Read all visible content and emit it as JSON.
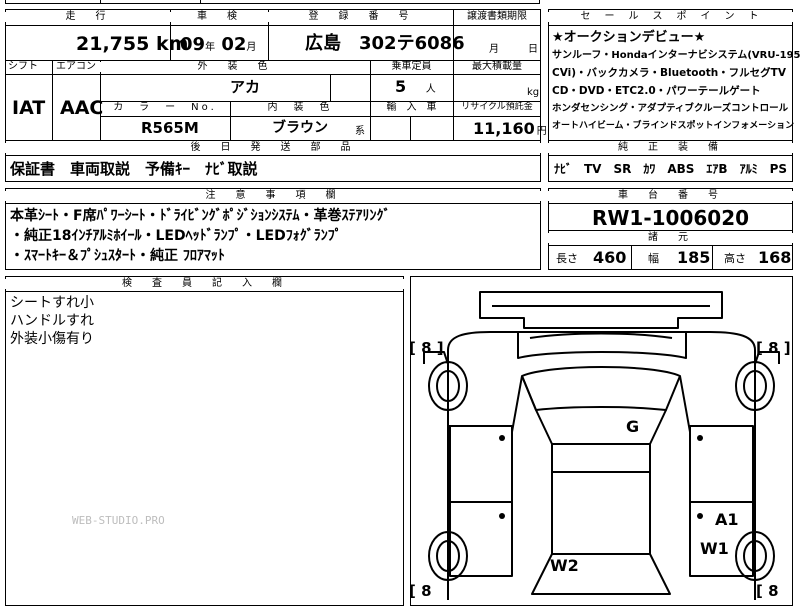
{
  "header": {
    "mileage_label": "走　行",
    "inspection_label": "車　検",
    "registration_label": "登　録　番　号",
    "transfer_label": "譲渡書類期限",
    "selling_label": "セ　ー　ル　ス　ポ　イ　ン　ト"
  },
  "mileage": {
    "value": "21,755",
    "unit": "km"
  },
  "inspection": {
    "year": "09",
    "year_unit": "年",
    "month": "02",
    "month_unit": "月"
  },
  "registration": {
    "value": "広島　302テ6086"
  },
  "transfer": {
    "month_unit": "月",
    "day_unit": "日"
  },
  "row2": {
    "shift_label": "シフト",
    "aircon_label": "エアコン",
    "exterior_label": "外　装　色",
    "capacity_label": "乗車定員",
    "load_label": "最大積載量",
    "shift": "IAT",
    "aircon": "AAC",
    "exterior": "アカ",
    "capacity": "5",
    "capacity_unit": "人",
    "load_unit": "kg",
    "colorno_label": "カ　ラ　ー　No.",
    "interior_label": "内　装　色",
    "import_label": "輸　入　車",
    "recycle_label": "リサイクル預託金",
    "colorno": "R565M",
    "interior": "ブラウン",
    "interior_unit": "系",
    "recycle": "11,160",
    "recycle_unit": "円"
  },
  "selling_points": [
    "★オークションデビュー★",
    "サンルーフ・Hondaインターナビシステム(VRU-195",
    "CVi)・バックカメラ・Bluetooth・フルセグTV",
    "CD・DVD・ETC2.0・パワーテールゲート",
    "ホンダセンシング・アダプティブクルーズコントロール",
    "オートハイビーム・ブラインドスポットインフォメーション"
  ],
  "rear_parts": {
    "label": "後　日　発　送　部　品",
    "value": "保証書　車両取説　予備ｷｰ　ﾅﾋﾞ取説"
  },
  "genuine": {
    "label": "純　正　装　備",
    "value": "ﾅﾋﾞ　TV　SR　ｶﾜ　ABS　ｴｱB　ｱﾙﾐ　PS　PW"
  },
  "notes": {
    "label": "注　意　事　項　欄",
    "lines": [
      "本革ｼｰﾄ・F席ﾊﾟﾜｰｼｰﾄ・ﾄﾞﾗｲﾋﾞﾝｸﾞﾎﾟｼﾞｼｮﾝｼｽﾃﾑ・革巻ｽﾃｱﾘﾝｸﾞ",
      "・純正18ｲﾝﾁｱﾙﾐﾎｲｰﾙ・LEDﾍｯﾄﾞﾗﾝﾌﾟ・LEDﾌｫｸﾞﾗﾝﾌﾟ",
      "・ｽﾏｰﾄｷｰ＆ﾌﾟｼｭｽﾀｰﾄ・純正 ﾌﾛｱﾏｯﾄ"
    ]
  },
  "chassis": {
    "label": "車　台　番　号",
    "value": "RW1-1006020"
  },
  "dims": {
    "label": "諸　元",
    "length_label": "長さ",
    "length": "460",
    "width_label": "幅",
    "width": "185",
    "height_label": "高さ",
    "height": "168"
  },
  "inspector": {
    "label": "検　査　員　記　入　欄",
    "lines": [
      "シートすれ小",
      "ハンドルすれ",
      "外装小傷有り"
    ]
  },
  "diagram": {
    "tire_tl": "[ 8 ]",
    "tire_tr": "[ 8 ]",
    "tire_bl": "[ 8",
    "tire_br": "[ 8",
    "mark_g": "G",
    "mark_a1": "A1",
    "mark_w1": "W1",
    "mark_w2": "W2"
  },
  "watermark": "WEB-STUDIO.PRO"
}
